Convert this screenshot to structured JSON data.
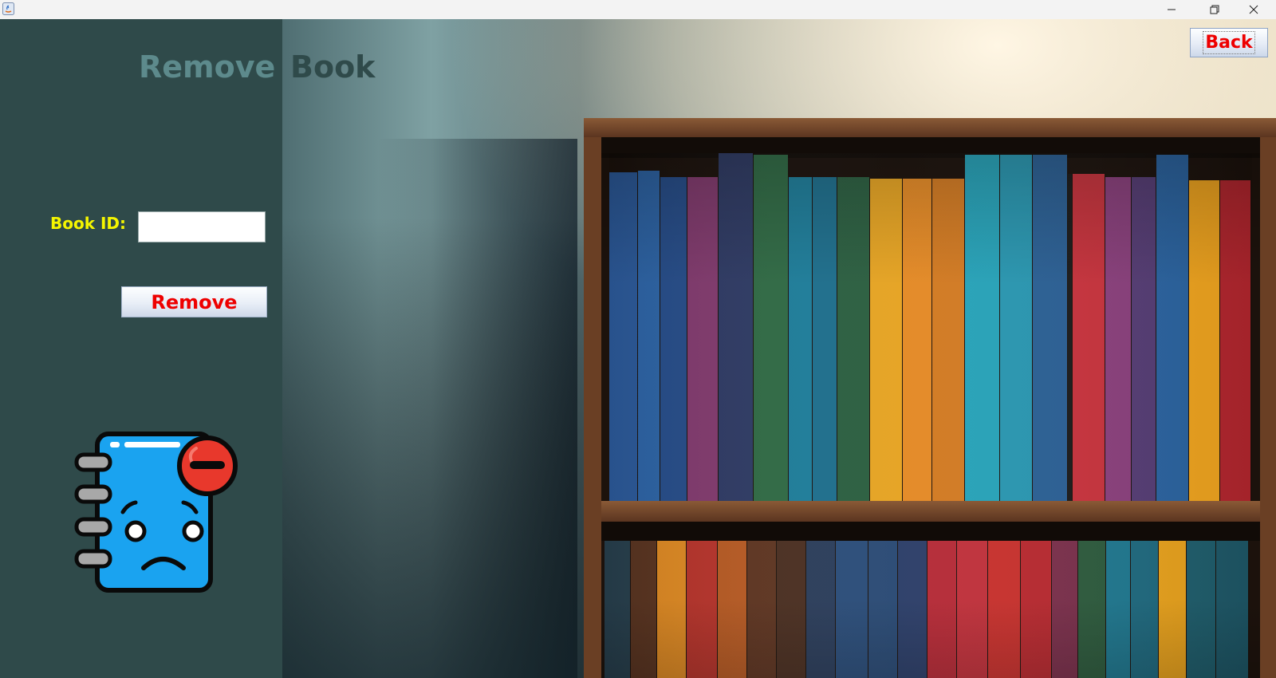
{
  "window": {
    "title": "",
    "controls": [
      "minimize",
      "restore",
      "close"
    ]
  },
  "header": {
    "title_word_1": "Remove",
    "title_word_2": "Book"
  },
  "form": {
    "book_id_label": "Book ID:",
    "book_id_value": "",
    "remove_label": "Remove"
  },
  "nav": {
    "back_label": "Back"
  },
  "colors": {
    "panel": "#2f4a4a",
    "label": "#f5f500",
    "button_text": "#ee0000",
    "title_light": "#5d8a8c",
    "icon_blue": "#1aa3f0",
    "icon_red": "#e8382c"
  },
  "icons": [
    "java-app-icon",
    "minimize-icon",
    "restore-icon",
    "close-icon",
    "remove-book-icon"
  ]
}
